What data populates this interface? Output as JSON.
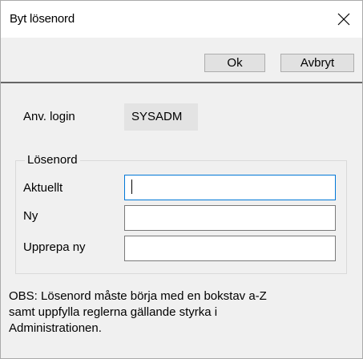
{
  "window": {
    "title": "Byt lösenord",
    "close_icon": "close-icon"
  },
  "toolbar": {
    "ok_label": "Ok",
    "cancel_label": "Avbryt"
  },
  "login": {
    "label": "Anv. login",
    "value": "SYSADM"
  },
  "password_group": {
    "legend": "Lösenord",
    "fields": [
      {
        "label": "Aktuellt",
        "value": ""
      },
      {
        "label": "Ny",
        "value": ""
      },
      {
        "label": "Upprepa ny",
        "value": ""
      }
    ]
  },
  "note": {
    "lines": [
      "OBS: Lösenord måste börja med en bokstav a-Z",
      "samt uppfylla reglerna gällande styrka i",
      "Administrationen."
    ]
  },
  "colors": {
    "focus_border": "#0078d7",
    "divider": "#666666",
    "dialog_bg": "#f0f0f0"
  }
}
